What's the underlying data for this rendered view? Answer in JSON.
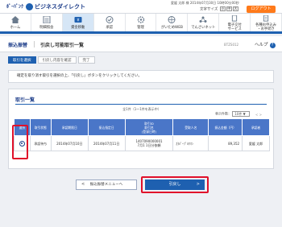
{
  "header": {
    "logo_small": "ﾎﾟｰﾊﾟﾝｸ",
    "logo_large": "ビジネスダイレクト",
    "user_line": "愛媛 太郎 様 2014年07月30日 10時00分00秒",
    "font_size_label": "文字サイズ",
    "font_small": "小",
    "font_medium": "中",
    "font_large": "大",
    "logout": "ログアウト"
  },
  "nav": [
    {
      "label": "ホーム",
      "icon": "home-icon"
    },
    {
      "label": "明細照会",
      "icon": "statement-icon"
    },
    {
      "label": "資金移動",
      "icon": "transfer-icon",
      "active": true
    },
    {
      "label": "承認",
      "icon": "approve-icon"
    },
    {
      "label": "管理",
      "icon": "gear-icon"
    },
    {
      "label": "がいためWEB",
      "icon": "globe-icon"
    },
    {
      "label": "でんさいネット",
      "icon": "network-icon"
    },
    {
      "label": "電子交付",
      "label2": "サービス",
      "icon": "document-icon"
    },
    {
      "label": "各種お申込み",
      "label2": "・お手続き",
      "icon": "form-icon"
    }
  ],
  "title": {
    "category": "振込振替",
    "page": "引戻し可能取引一覧",
    "code": "BTZS012",
    "help": "ヘルプ",
    "help_mark": "?"
  },
  "steps": [
    "取引を選択",
    "引戻し内容を確認",
    "完了"
  ],
  "notice": "確定を取り消す取引を選択の上、「引戻し」ボタンをクリックしてください。",
  "panel": {
    "title": "取引一覧",
    "count": "全1件（1～1件を表示中）",
    "per_page_label": "表示件数：",
    "per_page_value": "10件 ▼",
    "pager": "< >"
  },
  "table": {
    "headers": [
      "選択",
      "取引状態",
      "承認期限日",
      "振込指定日",
      "取引ID\n取引名\n(登録日時)",
      "受取人名",
      "振込金額（円）",
      "承認者"
    ],
    "rows": [
      [
        "",
        "承認待ち",
        "2014年07月10日",
        "2014年07月11日",
        "1407090000001\n7月1 1日分依頼",
        "ｶ)ﾊﾟｰﾌﾟﾙｳﾏﾝ",
        "89,352",
        "愛媛 太郎"
      ]
    ]
  },
  "buttons": {
    "back": "振込振替メニューへ",
    "next": "引戻し",
    "back_arrow": "<",
    "next_arrow": ">"
  }
}
